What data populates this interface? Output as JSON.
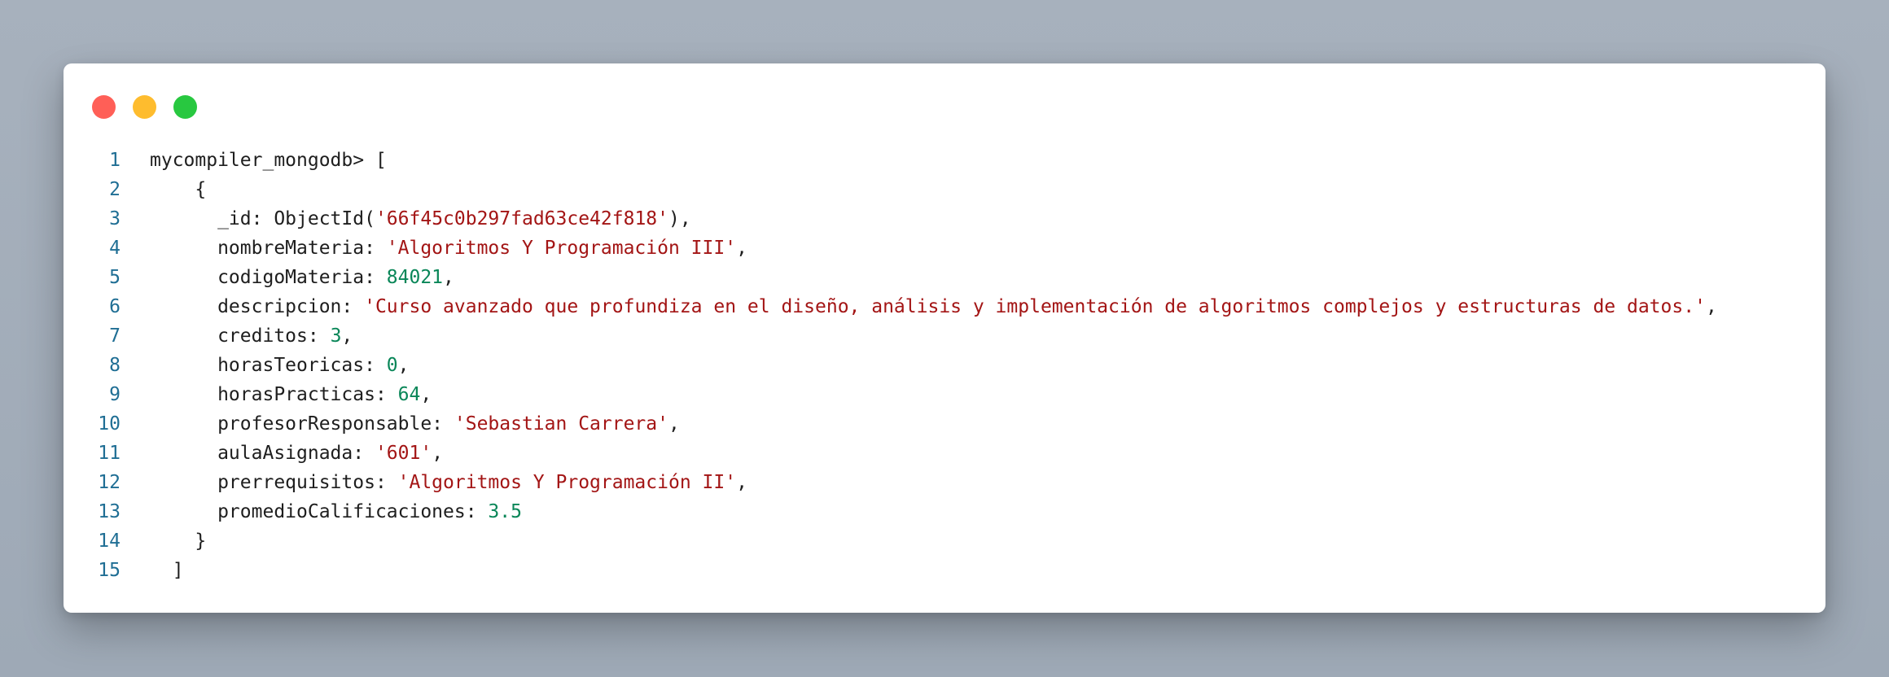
{
  "window": {
    "controls": [
      "close",
      "minimize",
      "maximize"
    ],
    "colors": {
      "close": "#ff5f57",
      "minimize": "#febc2e",
      "maximize": "#28c840"
    }
  },
  "code": {
    "lines": [
      {
        "n": "1",
        "tokens": [
          {
            "t": "mycompiler_mongodb> [",
            "k": "plain"
          }
        ]
      },
      {
        "n": "2",
        "tokens": [
          {
            "t": "    {",
            "k": "plain"
          }
        ]
      },
      {
        "n": "3",
        "tokens": [
          {
            "t": "      _id: ObjectId(",
            "k": "plain"
          },
          {
            "t": "'66f45c0b297fad63ce42f818'",
            "k": "str"
          },
          {
            "t": "),",
            "k": "plain"
          }
        ]
      },
      {
        "n": "4",
        "tokens": [
          {
            "t": "      nombreMateria: ",
            "k": "plain"
          },
          {
            "t": "'Algoritmos Y Programación III'",
            "k": "str"
          },
          {
            "t": ",",
            "k": "plain"
          }
        ]
      },
      {
        "n": "5",
        "tokens": [
          {
            "t": "      codigoMateria: ",
            "k": "plain"
          },
          {
            "t": "84021",
            "k": "num"
          },
          {
            "t": ",",
            "k": "plain"
          }
        ]
      },
      {
        "n": "6",
        "tokens": [
          {
            "t": "      descripcion: ",
            "k": "plain"
          },
          {
            "t": "'Curso avanzado que profundiza en el diseño, análisis y implementación de algoritmos complejos y estructuras de datos.'",
            "k": "str"
          },
          {
            "t": ",",
            "k": "plain"
          }
        ]
      },
      {
        "n": "7",
        "tokens": [
          {
            "t": "      creditos: ",
            "k": "plain"
          },
          {
            "t": "3",
            "k": "num"
          },
          {
            "t": ",",
            "k": "plain"
          }
        ]
      },
      {
        "n": "8",
        "tokens": [
          {
            "t": "      horasTeoricas: ",
            "k": "plain"
          },
          {
            "t": "0",
            "k": "num"
          },
          {
            "t": ",",
            "k": "plain"
          }
        ]
      },
      {
        "n": "9",
        "tokens": [
          {
            "t": "      horasPracticas: ",
            "k": "plain"
          },
          {
            "t": "64",
            "k": "num"
          },
          {
            "t": ",",
            "k": "plain"
          }
        ]
      },
      {
        "n": "10",
        "tokens": [
          {
            "t": "      profesorResponsable: ",
            "k": "plain"
          },
          {
            "t": "'Sebastian Carrera'",
            "k": "str"
          },
          {
            "t": ",",
            "k": "plain"
          }
        ]
      },
      {
        "n": "11",
        "tokens": [
          {
            "t": "      aulaAsignada: ",
            "k": "plain"
          },
          {
            "t": "'601'",
            "k": "str"
          },
          {
            "t": ",",
            "k": "plain"
          }
        ]
      },
      {
        "n": "12",
        "tokens": [
          {
            "t": "      prerrequisitos: ",
            "k": "plain"
          },
          {
            "t": "'Algoritmos Y Programación II'",
            "k": "str"
          },
          {
            "t": ",",
            "k": "plain"
          }
        ]
      },
      {
        "n": "13",
        "tokens": [
          {
            "t": "      promedioCalificaciones: ",
            "k": "plain"
          },
          {
            "t": "3.5",
            "k": "num"
          }
        ]
      },
      {
        "n": "14",
        "tokens": [
          {
            "t": "    }",
            "k": "plain"
          }
        ]
      },
      {
        "n": "15",
        "tokens": [
          {
            "t": "  ]",
            "k": "plain"
          }
        ]
      }
    ]
  },
  "colors": {
    "string": "#a31515",
    "number": "#098658",
    "line_number": "#1f6e94",
    "text": "#1e1e1e"
  }
}
